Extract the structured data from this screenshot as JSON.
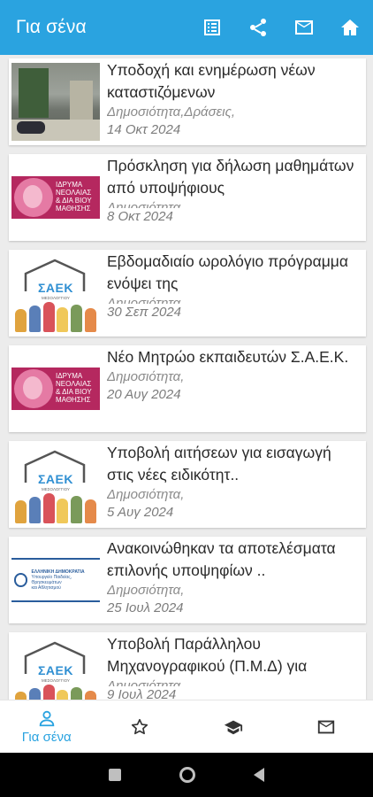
{
  "appbar": {
    "title": "Για σένα",
    "actions": [
      {
        "icon": "list-icon"
      },
      {
        "icon": "share-icon"
      },
      {
        "icon": "mail-icon"
      },
      {
        "icon": "home-icon"
      }
    ]
  },
  "articles": [
    {
      "headline": "Υποδοχή και ενημέρωση νέων καταστιζόμενων",
      "category": "Δημοσιότητα,Δράσεις,",
      "date": "14 Οκτ 2024",
      "thumbnail": "classroom-photo"
    },
    {
      "headline": "Πρόσκληση για δήλωση μαθημάτων από υποψήφιους",
      "category": "Δημοσιότητα",
      "date": "8 Οκτ 2024",
      "thumbnail": "idryma-logo"
    },
    {
      "headline": "Εβδομαδιαίο ωρολόγιο πρόγραμμα ενόψει της",
      "category": "Δημοσιότητα",
      "date": "30 Σεπ 2024",
      "thumbnail": "saek-logo"
    },
    {
      "headline": "Νέο Μητρώο εκπαιδευτών Σ.Α.Ε.Κ.",
      "category": "Δημοσιότητα,",
      "date": "20 Αυγ 2024",
      "thumbnail": "idryma-logo"
    },
    {
      "headline": "Υποβολή αιτήσεων για εισαγωγή στις νέες ειδικότητ..",
      "category": "Δημοσιότητα,",
      "date": "5 Αυγ 2024",
      "thumbnail": "saek-logo"
    },
    {
      "headline": "Ανακοινώθηκαν τα αποτελέσματα επιλονής υποψηφίων ..",
      "category": "Δημοσιότητα,",
      "date": "25 Ιουλ 2024",
      "thumbnail": "ministry-logo"
    },
    {
      "headline": "Υποβολή Παράλληλου Μηχανογραφικού (Π.Μ.Δ) για",
      "category": "Δημοσιότητα",
      "date": "9 Ιουλ 2024",
      "thumbnail": "saek-logo"
    }
  ],
  "thumbnail_text": {
    "idryma": [
      "ΙΔΡΥΜΑ",
      "ΝΕΟΛΑΙΑΣ",
      "& ΔΙΑ ΒΙΟΥ",
      "ΜΑΘΗΣΗΣ"
    ],
    "saek": "ΣΑΕΚ",
    "saek_sub": "ΜΕΣΟΛΟΓΓΙΟΥ",
    "ministry": [
      "ΕΛΛΗΝΙΚΗ ΔΗΜΟΚΡΑΤΙΑ",
      "Υπουργείο Παιδείας, Θρησκευμάτων",
      "και Αθλητισμού"
    ]
  },
  "bottom_nav": {
    "items": [
      {
        "icon": "person-icon",
        "label": "Για σένα",
        "active": true
      },
      {
        "icon": "star-icon",
        "label": "",
        "active": false
      },
      {
        "icon": "graduation-cap-icon",
        "label": "",
        "active": false
      },
      {
        "icon": "mail-icon",
        "label": "",
        "active": false
      }
    ]
  },
  "colors": {
    "primary": "#2aa3e0",
    "idryma": "#b5285f",
    "saek_blue": "#2f8fd2",
    "ministry_blue": "#2a5d9c"
  }
}
